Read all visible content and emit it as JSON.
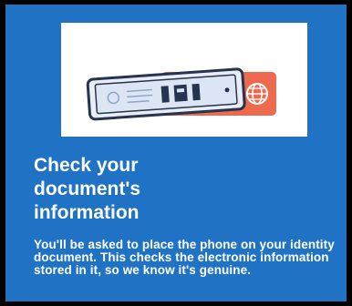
{
  "screen": {
    "title": "Check your\ndocument's\ninformation",
    "body": "You'll be asked to place the phone on your identity document. This checks the electronic information stored in it, so we know it's genuine."
  },
  "colors": {
    "background": "#1f72c4",
    "card": "#ffffff",
    "document_accent": "#ee6a4f",
    "phone_outline": "#26344f"
  },
  "illustration": {
    "icon": "phone-on-passport-illustration"
  }
}
